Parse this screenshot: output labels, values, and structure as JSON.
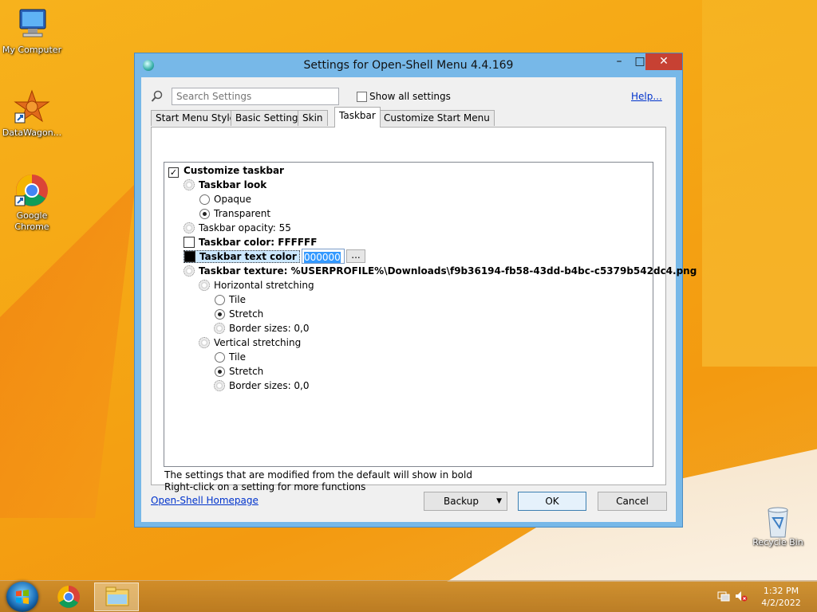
{
  "desktop": {
    "icons": [
      {
        "label": "My Computer",
        "icon": "computer-icon"
      },
      {
        "label": "DataWagon...",
        "icon": "datawagon-icon"
      },
      {
        "label": "Google Chrome",
        "icon": "chrome-icon"
      },
      {
        "label": "Recycle Bin",
        "icon": "recycle-bin-icon"
      }
    ]
  },
  "window": {
    "title": "Settings for Open-Shell Menu 4.4.169",
    "controls": {
      "minimize": "–",
      "maximize": "□",
      "close": "✕"
    }
  },
  "search": {
    "placeholder": "Search Settings"
  },
  "show_all": {
    "label": "Show all settings",
    "checked": false
  },
  "help_link": "Help...",
  "tabs": [
    {
      "label": "Start Menu Style",
      "active": false
    },
    {
      "label": "Basic Settings",
      "active": false
    },
    {
      "label": "Skin",
      "active": false
    },
    {
      "label": "Taskbar",
      "active": true
    },
    {
      "label": "Customize Start Menu",
      "active": false
    }
  ],
  "tree": {
    "customize_taskbar": "Customize taskbar",
    "taskbar_look": "Taskbar look",
    "opaque": "Opaque",
    "transparent": "Transparent",
    "opacity": "Taskbar opacity: 55",
    "color": "Taskbar color: FFFFFF",
    "text_color_label": "Taskbar text color",
    "text_color_value": "000000",
    "dots": "...",
    "texture": "Taskbar texture: %USERPROFILE%\\Downloads\\f9b36194-fb58-43dd-b4bc-c5379b542dc4.png",
    "h_stretch": "Horizontal stretching",
    "h_tile": "Tile",
    "h_stretch_opt": "Stretch",
    "h_border": "Border sizes: 0,0",
    "v_stretch": "Vertical stretching",
    "v_tile": "Tile",
    "v_stretch_opt": "Stretch",
    "v_border": "Border sizes: 0,0"
  },
  "notes": {
    "line1": "The settings that are modified from the default will show in bold",
    "line2": "Right-click on a setting for more functions"
  },
  "footer": {
    "homepage": "Open-Shell Homepage",
    "backup": "Backup",
    "ok": "OK",
    "cancel": "Cancel"
  },
  "taskbar": {
    "time": "1:32 PM",
    "date": "4/2/2022"
  }
}
